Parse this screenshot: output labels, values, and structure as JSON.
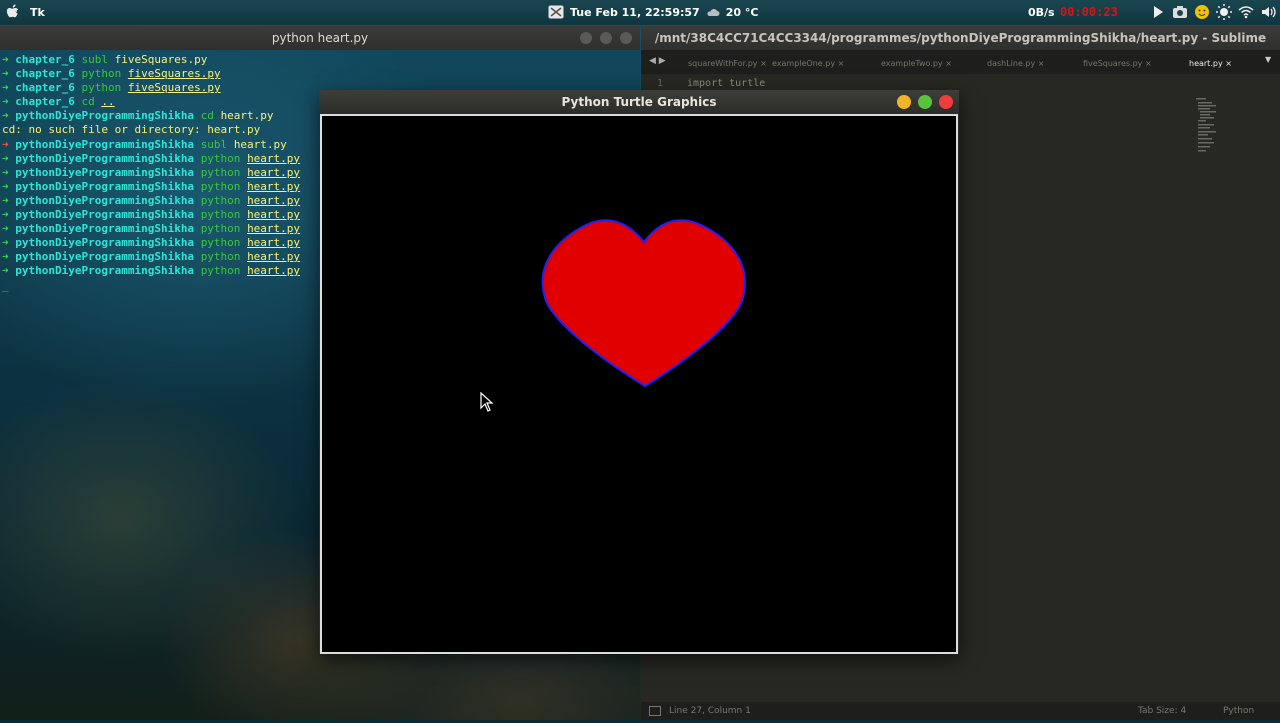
{
  "top_panel": {
    "app_name": "Tk",
    "datetime": "Tue Feb 11, 22:59:57",
    "temperature": "20 °C",
    "net_speed": "0B/s",
    "rec_timer": "00:00:23",
    "colors": {
      "timer": "#e01010"
    }
  },
  "terminal": {
    "title": "python heart.py",
    "lines": [
      {
        "arrow": "➜",
        "arrow_color": "green",
        "dir": "chapter_6",
        "cmd": "subl",
        "arg": "fiveSquares.py",
        "underline": false
      },
      {
        "arrow": "➜",
        "arrow_color": "green",
        "dir": "chapter_6",
        "cmd": "python",
        "arg": "fiveSquares.py",
        "underline": true
      },
      {
        "arrow": "➜",
        "arrow_color": "green",
        "dir": "chapter_6",
        "cmd": "python",
        "arg": "fiveSquares.py",
        "underline": true
      },
      {
        "arrow": "➜",
        "arrow_color": "green",
        "dir": "chapter_6",
        "cmd": "cd",
        "arg": "..",
        "underline": true
      },
      {
        "arrow": "➜",
        "arrow_color": "green",
        "dir": "pythonDiyeProgrammingShikha",
        "cmd": "cd",
        "arg": "heart.py",
        "underline": false
      },
      {
        "error": "cd: no such file or directory: heart.py"
      },
      {
        "arrow": "➜",
        "arrow_color": "red",
        "dir": "pythonDiyeProgrammingShikha",
        "cmd": "subl",
        "arg": "heart.py",
        "underline": false
      },
      {
        "arrow": "➜",
        "arrow_color": "green",
        "dir": "pythonDiyeProgrammingShikha",
        "cmd": "python",
        "arg": "heart.py",
        "underline": true
      },
      {
        "arrow": "➜",
        "arrow_color": "green",
        "dir": "pythonDiyeProgrammingShikha",
        "cmd": "python",
        "arg": "heart.py",
        "underline": true
      },
      {
        "arrow": "➜",
        "arrow_color": "green",
        "dir": "pythonDiyeProgrammingShikha",
        "cmd": "python",
        "arg": "heart.py",
        "underline": true
      },
      {
        "arrow": "➜",
        "arrow_color": "green",
        "dir": "pythonDiyeProgrammingShikha",
        "cmd": "python",
        "arg": "heart.py",
        "underline": true
      },
      {
        "arrow": "➜",
        "arrow_color": "green",
        "dir": "pythonDiyeProgrammingShikha",
        "cmd": "python",
        "arg": "heart.py",
        "underline": true
      },
      {
        "arrow": "➜",
        "arrow_color": "green",
        "dir": "pythonDiyeProgrammingShikha",
        "cmd": "python",
        "arg": "heart.py",
        "underline": true
      },
      {
        "arrow": "➜",
        "arrow_color": "green",
        "dir": "pythonDiyeProgrammingShikha",
        "cmd": "python",
        "arg": "heart.py",
        "underline": true
      },
      {
        "arrow": "➜",
        "arrow_color": "green",
        "dir": "pythonDiyeProgrammingShikha",
        "cmd": "python",
        "arg": "heart.py",
        "underline": true
      },
      {
        "arrow": "➜",
        "arrow_color": "green",
        "dir": "pythonDiyeProgrammingShikha",
        "cmd": "python",
        "arg": "heart.py",
        "underline": true
      }
    ],
    "cursor": "_"
  },
  "sublime": {
    "title": "/mnt/38C4CC71C4CC3344/programmes/pythonDiyeProgrammingShikha/heart.py - Sublime Text",
    "tab_nav": "◀ ▶",
    "tabs": [
      {
        "label": "squareWithFor.py",
        "active": false
      },
      {
        "label": "exampleOne.py",
        "active": false
      },
      {
        "label": "exampleTwo.py",
        "active": false
      },
      {
        "label": "dashLine.py",
        "active": false
      },
      {
        "label": "fiveSquares.py",
        "active": false
      },
      {
        "label": "heart.py",
        "active": true
      }
    ],
    "tab_close": "×",
    "tab_menu": "▼",
    "line_number": "1",
    "code_first_line": "import turtle",
    "status_left": "Line 27, Column 1",
    "status_tab_size": "Tab Size: 4",
    "status_syntax": "Python"
  },
  "turtle_window": {
    "title": "Python Turtle Graphics",
    "heart": {
      "fill": "#e00000",
      "outline": "#2020ff"
    },
    "canvas_bg": "#000000"
  }
}
